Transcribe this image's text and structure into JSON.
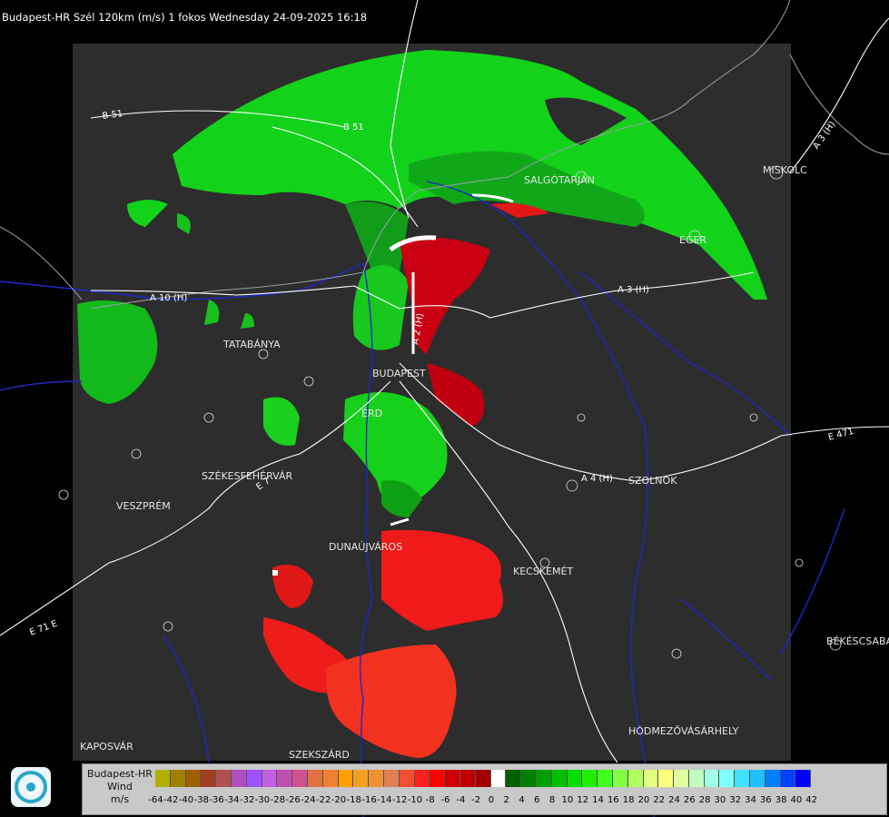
{
  "title": "Budapest-HR Szél 120km (m/s) 1 fokos Wednesday 24-09-2025 16:18",
  "cities": [
    {
      "id": "salgotarjan",
      "name": "SALGÓTARJÁN"
    },
    {
      "id": "miskolc",
      "name": "MISKOLC"
    },
    {
      "id": "eger",
      "name": "EGER"
    },
    {
      "id": "tatabanya",
      "name": "TATABÁNYA"
    },
    {
      "id": "budapest",
      "name": "BUDAPEST"
    },
    {
      "id": "erd",
      "name": "ÉRD"
    },
    {
      "id": "szekesfehervar",
      "name": "SZÉKESFEHÉRVÁR"
    },
    {
      "id": "veszprem",
      "name": "VESZPRÉM"
    },
    {
      "id": "dunaujvaros",
      "name": "DUNAÚJVÁROS"
    },
    {
      "id": "kecskemet",
      "name": "KECSKEMÉT"
    },
    {
      "id": "szolnok",
      "name": "SZOLNOK"
    },
    {
      "id": "bekescsaba",
      "name": "BÉKÉSCSABA"
    },
    {
      "id": "hodmezovasarhely",
      "name": "HÓDMEZŐVÁSÁRHELY"
    },
    {
      "id": "kaposvar",
      "name": "KAPOSVÁR"
    },
    {
      "id": "szekszard",
      "name": "SZEKSZÁRD"
    }
  ],
  "roads": [
    {
      "id": "b51a",
      "name": "B 51"
    },
    {
      "id": "b51b",
      "name": "B 51"
    },
    {
      "id": "a3a",
      "name": "A 3 (H)"
    },
    {
      "id": "a3b",
      "name": "A 3 (H)"
    },
    {
      "id": "a10",
      "name": "A 10 (H)"
    },
    {
      "id": "a4",
      "name": "A 4 (H)"
    },
    {
      "id": "e471",
      "name": "E 471"
    },
    {
      "id": "e71",
      "name": "E 71 E"
    },
    {
      "id": "a2",
      "name": "A 2 (H)"
    },
    {
      "id": "e7",
      "name": "E 7"
    }
  ],
  "legend": {
    "line1": "Budapest-HR",
    "line2": "Wind",
    "line3": "m/s",
    "colors": [
      "#b0b000",
      "#a08000",
      "#a06000",
      "#a04020",
      "#b05050",
      "#b050c0",
      "#a050ff",
      "#c060e0",
      "#c050b0",
      "#d05090",
      "#e07040",
      "#f08030",
      "#ffa000",
      "#f0a020",
      "#f09030",
      "#e08050",
      "#f05030",
      "#ff2020",
      "#ff0000",
      "#d00000",
      "#c00000",
      "#a00000",
      "#ffffff",
      "#006000",
      "#008000",
      "#00a000",
      "#00c000",
      "#00e000",
      "#20f000",
      "#40ff20",
      "#80ff40",
      "#b0ff60",
      "#e0ff80",
      "#ffff80",
      "#e0ffa0",
      "#c0ffc0",
      "#a0ffe0",
      "#80ffff",
      "#40e0ff",
      "#20c0ff",
      "#0080ff",
      "#0040ff",
      "#0000ff"
    ],
    "ticks": [
      "-64",
      "-42",
      "-40",
      "-38",
      "-36",
      "-34",
      "-32",
      "-30",
      "-28",
      "-26",
      "-24",
      "-22",
      "-20",
      "-18",
      "-16",
      "-14",
      "-12",
      "-10",
      "-8",
      "-6",
      "-4",
      "-2",
      "0",
      "2",
      "4",
      "6",
      "8",
      "10",
      "12",
      "14",
      "16",
      "18",
      "20",
      "22",
      "24",
      "26",
      "28",
      "30",
      "32",
      "34",
      "36",
      "38",
      "40",
      "42"
    ]
  }
}
